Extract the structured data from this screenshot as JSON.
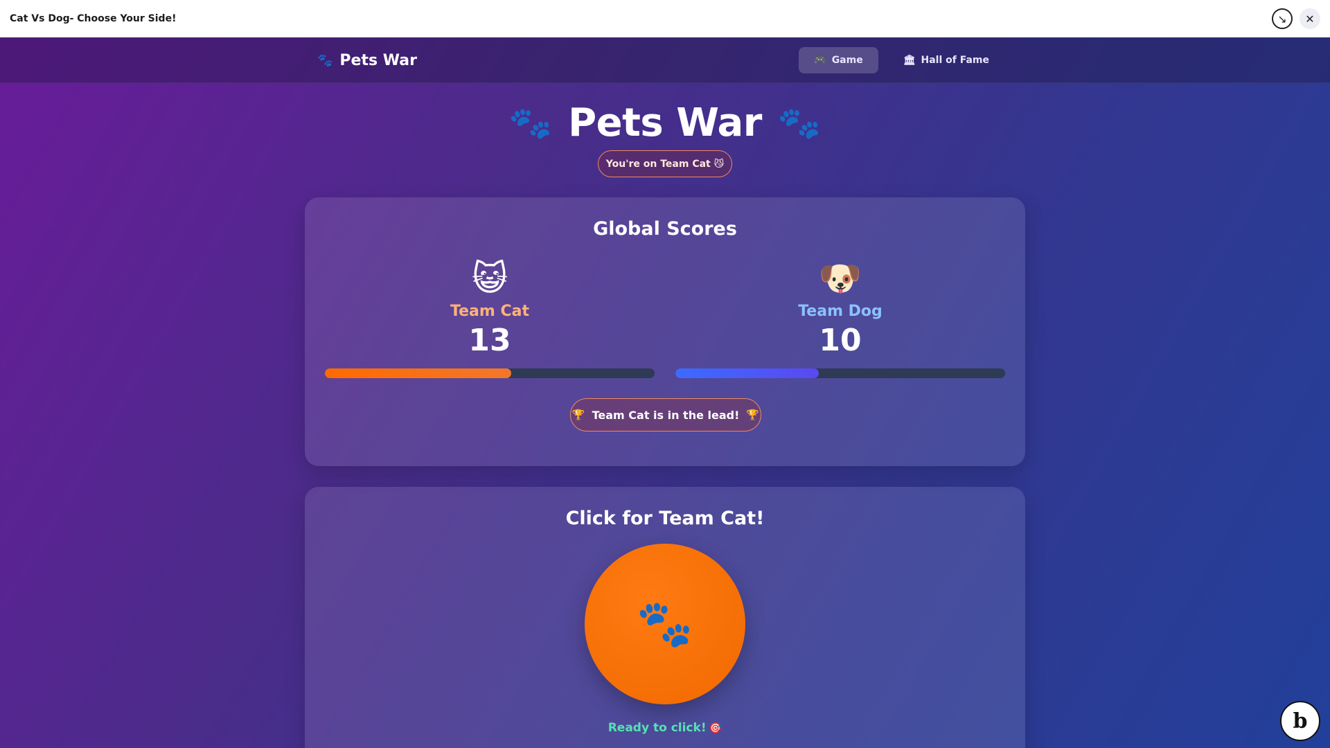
{
  "window": {
    "title": "Cat Vs Dog- Choose Your Side!",
    "collapse_icon": "↘",
    "close_icon": "✕"
  },
  "nav": {
    "brand": "Pets War",
    "brand_icon": "🐾",
    "links": [
      {
        "icon": "🎮",
        "label": "Game",
        "active": true
      },
      {
        "icon": "🏛",
        "label": "Hall of Fame",
        "active": false
      }
    ]
  },
  "hero": {
    "title": "Pets War",
    "paw_icon": "🐾",
    "team_badge": "You're on Team Cat 😼"
  },
  "scores": {
    "title": "Global Scores",
    "cat": {
      "emoji": "😺",
      "name": "Team Cat",
      "score": "13",
      "progress": 0.565
    },
    "dog": {
      "emoji": "🐶",
      "name": "Team Dog",
      "score": "10",
      "progress": 0.435
    },
    "lead_text": "Team Cat is in the lead!",
    "trophy_icon": "🏆"
  },
  "click": {
    "title": "Click for Team Cat!",
    "button_icon": "🐾",
    "status": "Ready to click!",
    "status_icon": "🎯"
  },
  "badge": {
    "letter": "b"
  },
  "colors": {
    "cat_accent": "#ff6a00",
    "dog_accent": "#3b6bff",
    "status": "#58e0b2"
  }
}
